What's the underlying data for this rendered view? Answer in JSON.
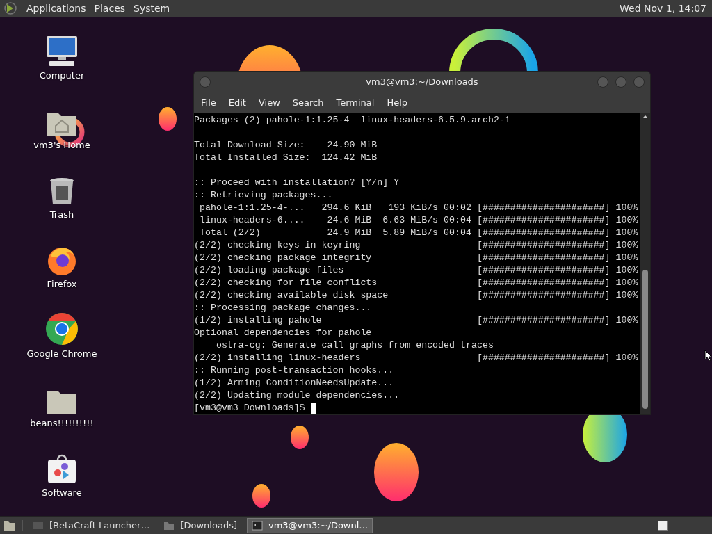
{
  "top_panel": {
    "menus": [
      "Applications",
      "Places",
      "System"
    ],
    "clock": "Wed Nov 1, 14:07"
  },
  "desktop_icons": [
    {
      "kind": "computer",
      "label": "Computer"
    },
    {
      "kind": "home",
      "label": "vm3's Home"
    },
    {
      "kind": "trash",
      "label": "Trash"
    },
    {
      "kind": "firefox",
      "label": "Firefox"
    },
    {
      "kind": "chrome",
      "label": "Google Chrome"
    },
    {
      "kind": "folder",
      "label": "beans!!!!!!!!!!"
    },
    {
      "kind": "software",
      "label": "Software"
    }
  ],
  "terminal": {
    "title": "vm3@vm3:~/Downloads",
    "menus": [
      "File",
      "Edit",
      "View",
      "Search",
      "Terminal",
      "Help"
    ],
    "lines": [
      {
        "text": "Packages (2) pahole-1:1.25-4  linux-headers-6.5.9.arch2-1",
        "gap_before": false
      },
      {
        "text": "Total Download Size:    24.90 MiB",
        "gap_before": true
      },
      {
        "text": "Total Installed Size:  124.42 MiB",
        "gap_before": false
      },
      {
        "text": ":: Proceed with installation? [Y/n] Y",
        "gap_before": true
      },
      {
        "text": ":: Retrieving packages...",
        "gap_before": false
      },
      {
        "text": " pahole-1:1.25-4-...   294.6 KiB   193 KiB/s 00:02 [######################] 100%",
        "gap_before": false
      },
      {
        "text": " linux-headers-6....    24.6 MiB  6.63 MiB/s 00:04 [######################] 100%",
        "gap_before": false
      },
      {
        "text": " Total (2/2)            24.9 MiB  5.89 MiB/s 00:04 [######################] 100%",
        "gap_before": false
      },
      {
        "text": "(2/2) checking keys in keyring                     [######################] 100%",
        "gap_before": false
      },
      {
        "text": "(2/2) checking package integrity                   [######################] 100%",
        "gap_before": false
      },
      {
        "text": "(2/2) loading package files                        [######################] 100%",
        "gap_before": false
      },
      {
        "text": "(2/2) checking for file conflicts                  [######################] 100%",
        "gap_before": false
      },
      {
        "text": "(2/2) checking available disk space                [######################] 100%",
        "gap_before": false
      },
      {
        "text": ":: Processing package changes...",
        "gap_before": false
      },
      {
        "text": "(1/2) installing pahole                            [######################] 100%",
        "gap_before": false
      },
      {
        "text": "Optional dependencies for pahole",
        "gap_before": false
      },
      {
        "text": "    ostra-cg: Generate call graphs from encoded traces",
        "gap_before": false
      },
      {
        "text": "(2/2) installing linux-headers                     [######################] 100%",
        "gap_before": false
      },
      {
        "text": ":: Running post-transaction hooks...",
        "gap_before": false
      },
      {
        "text": "(1/2) Arming ConditionNeedsUpdate...",
        "gap_before": false
      },
      {
        "text": "(2/2) Updating module dependencies...",
        "gap_before": false
      }
    ],
    "prompt": "[vm3@vm3 Downloads]$"
  },
  "taskbar": {
    "tasks": [
      {
        "kind": "app",
        "label": "[BetaCraft Launcher…",
        "selected": false
      },
      {
        "kind": "folder",
        "label": "[Downloads]",
        "selected": false
      },
      {
        "kind": "terminal",
        "label": "vm3@vm3:~/Downl…",
        "selected": true
      }
    ]
  }
}
